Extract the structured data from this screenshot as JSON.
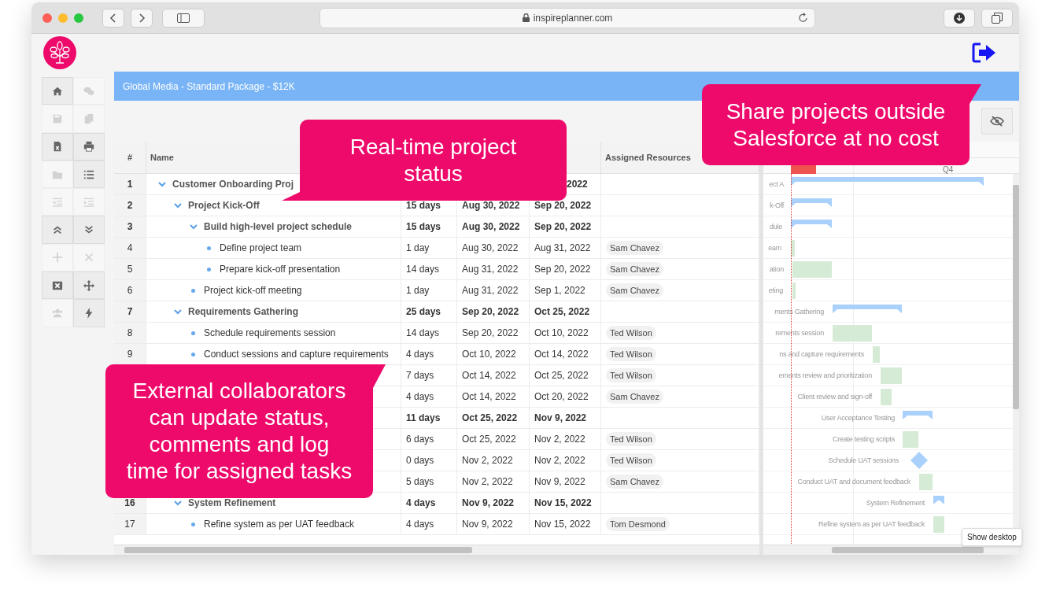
{
  "browser": {
    "url": "inspireplanner.com"
  },
  "project_title": "Global Media - Standard Package - $12K",
  "sidebar": {
    "tools": [
      {
        "kind": "home",
        "disabled": false
      },
      {
        "kind": "chat",
        "disabled": true
      },
      {
        "kind": "save",
        "disabled": true
      },
      {
        "kind": "copy",
        "disabled": true
      },
      {
        "kind": "excel",
        "disabled": false
      },
      {
        "kind": "print",
        "disabled": false
      },
      {
        "kind": "folder",
        "disabled": true
      },
      {
        "kind": "list",
        "disabled": false
      },
      {
        "kind": "outdent",
        "disabled": true
      },
      {
        "kind": "indent",
        "disabled": true
      },
      {
        "kind": "collapse",
        "disabled": false
      },
      {
        "kind": "expand",
        "disabled": false
      },
      {
        "kind": "add",
        "disabled": true
      },
      {
        "kind": "remove",
        "disabled": true
      },
      {
        "kind": "clear",
        "disabled": false
      },
      {
        "kind": "move",
        "disabled": false
      },
      {
        "kind": "users",
        "disabled": true
      },
      {
        "kind": "bolt",
        "disabled": false
      }
    ]
  },
  "table": {
    "columns": [
      "#",
      "Name",
      "Assigned Resources"
    ],
    "rows": [
      {
        "num": "1",
        "name": "Customer Onboarding Proj",
        "kind": "summary",
        "expanded": true,
        "finish": "2022",
        "children": [
          {
            "num": "2",
            "name": "Project Kick-Off",
            "kind": "summary",
            "expanded": true,
            "duration": "15 days",
            "start": "Aug 30, 2022",
            "finish": "Sep 20, 2022",
            "children": [
              {
                "num": "3",
                "name": "Build high-level project schedule",
                "kind": "summary",
                "expanded": true,
                "duration": "15 days",
                "start": "Aug 30, 2022",
                "finish": "Sep 20, 2022",
                "children": [
                  {
                    "num": "4",
                    "name": "Define project team",
                    "kind": "task",
                    "duration": "1 day",
                    "start": "Aug 30, 2022",
                    "finish": "Aug 31, 2022",
                    "resource": "Sam Chavez"
                  },
                  {
                    "num": "5",
                    "name": "Prepare kick-off presentation",
                    "kind": "task",
                    "duration": "14 days",
                    "start": "Aug 31, 2022",
                    "finish": "Sep 20, 2022",
                    "resource": "Sam Chavez"
                  }
                ]
              },
              {
                "num": "6",
                "name": "Project kick-off meeting",
                "kind": "task",
                "duration": "1 day",
                "start": "Aug 31, 2022",
                "finish": "Sep 1, 2022",
                "resource": "Sam Chavez"
              }
            ]
          },
          {
            "num": "7",
            "name": "Requirements Gathering",
            "kind": "summary",
            "expanded": true,
            "duration": "25 days",
            "start": "Sep 20, 2022",
            "finish": "Oct 25, 2022",
            "children": [
              {
                "num": "8",
                "name": "Schedule requirements session",
                "kind": "task",
                "duration": "14 days",
                "start": "Sep 20, 2022",
                "finish": "Oct 10, 2022",
                "resource": "Ted Wilson"
              },
              {
                "num": "9",
                "name": "Conduct sessions and capture requirements",
                "kind": "task",
                "duration": "4 days",
                "start": "Oct 10, 2022",
                "finish": "Oct 14, 2022",
                "resource": "Ted Wilson"
              },
              {
                "kind": "task",
                "duration": "7 days",
                "start": "Oct 14, 2022",
                "finish": "Oct 25, 2022",
                "resource": "Ted Wilson"
              },
              {
                "kind": "task",
                "duration": "4 days",
                "start": "Oct 14, 2022",
                "finish": "Oct 20, 2022",
                "resource": "Sam Chavez"
              }
            ]
          },
          {
            "kind": "summary",
            "duration": "11 days",
            "start": "Oct 25, 2022",
            "finish": "Nov 9, 2022",
            "children": [
              {
                "kind": "task",
                "duration": "6 days",
                "start": "Oct 25, 2022",
                "finish": "Nov 2, 2022",
                "resource": "Ted Wilson"
              },
              {
                "kind": "task",
                "duration": "0 days",
                "start": "Nov 2, 2022",
                "finish": "Nov 2, 2022",
                "resource": "Ted Wilson"
              },
              {
                "kind": "task",
                "duration": "5 days",
                "start": "Nov 2, 2022",
                "finish": "Nov 9, 2022",
                "resource": "Sam Chavez"
              }
            ]
          },
          {
            "num": "16",
            "name": "System Refinement",
            "kind": "summary",
            "expanded": true,
            "duration": "4 days",
            "start": "Nov 9, 2022",
            "finish": "Nov 15, 2022",
            "children": [
              {
                "num": "17",
                "name": "Refine system as per UAT feedback",
                "kind": "task",
                "duration": "4 days",
                "start": "Nov 9, 2022",
                "finish": "Nov 15, 2022",
                "resource": "Tom Desmond"
              }
            ]
          }
        ]
      }
    ]
  },
  "gantt": {
    "period": "Q4",
    "rows": [
      {
        "label": "ect A",
        "kind": "summary"
      },
      {
        "label": "k-Off",
        "kind": "summary"
      },
      {
        "label": "dule",
        "kind": "summary"
      },
      {
        "label": "eam",
        "kind": "task"
      },
      {
        "label": "ation",
        "kind": "task"
      },
      {
        "label": "eting",
        "kind": "task"
      },
      {
        "label": "ments Gathering",
        "kind": "summary"
      },
      {
        "label": "rements session",
        "kind": "task"
      },
      {
        "label": "ns and capture requirements",
        "kind": "task"
      },
      {
        "label": "ements review and prioritization",
        "kind": "task"
      },
      {
        "label": "Client review and sign-off",
        "kind": "task"
      },
      {
        "label": "User Acceptance Testing",
        "kind": "summary"
      },
      {
        "label": "Create testing scripts",
        "kind": "task"
      },
      {
        "label": "Schedule UAT sessions",
        "kind": "milestone"
      },
      {
        "label": "Conduct UAT and document feedback",
        "kind": "task"
      },
      {
        "label": "System Refinement",
        "kind": "summary"
      },
      {
        "label": "Refine system as per UAT feedback",
        "kind": "task"
      }
    ]
  },
  "callouts": [
    "Real-time project\nstatus",
    "Share projects outside\nSalesforce at no cost",
    "External collaborators\ncan update status,\ncomments and log\ntime for assigned tasks"
  ],
  "tooltip": "Show desktop"
}
